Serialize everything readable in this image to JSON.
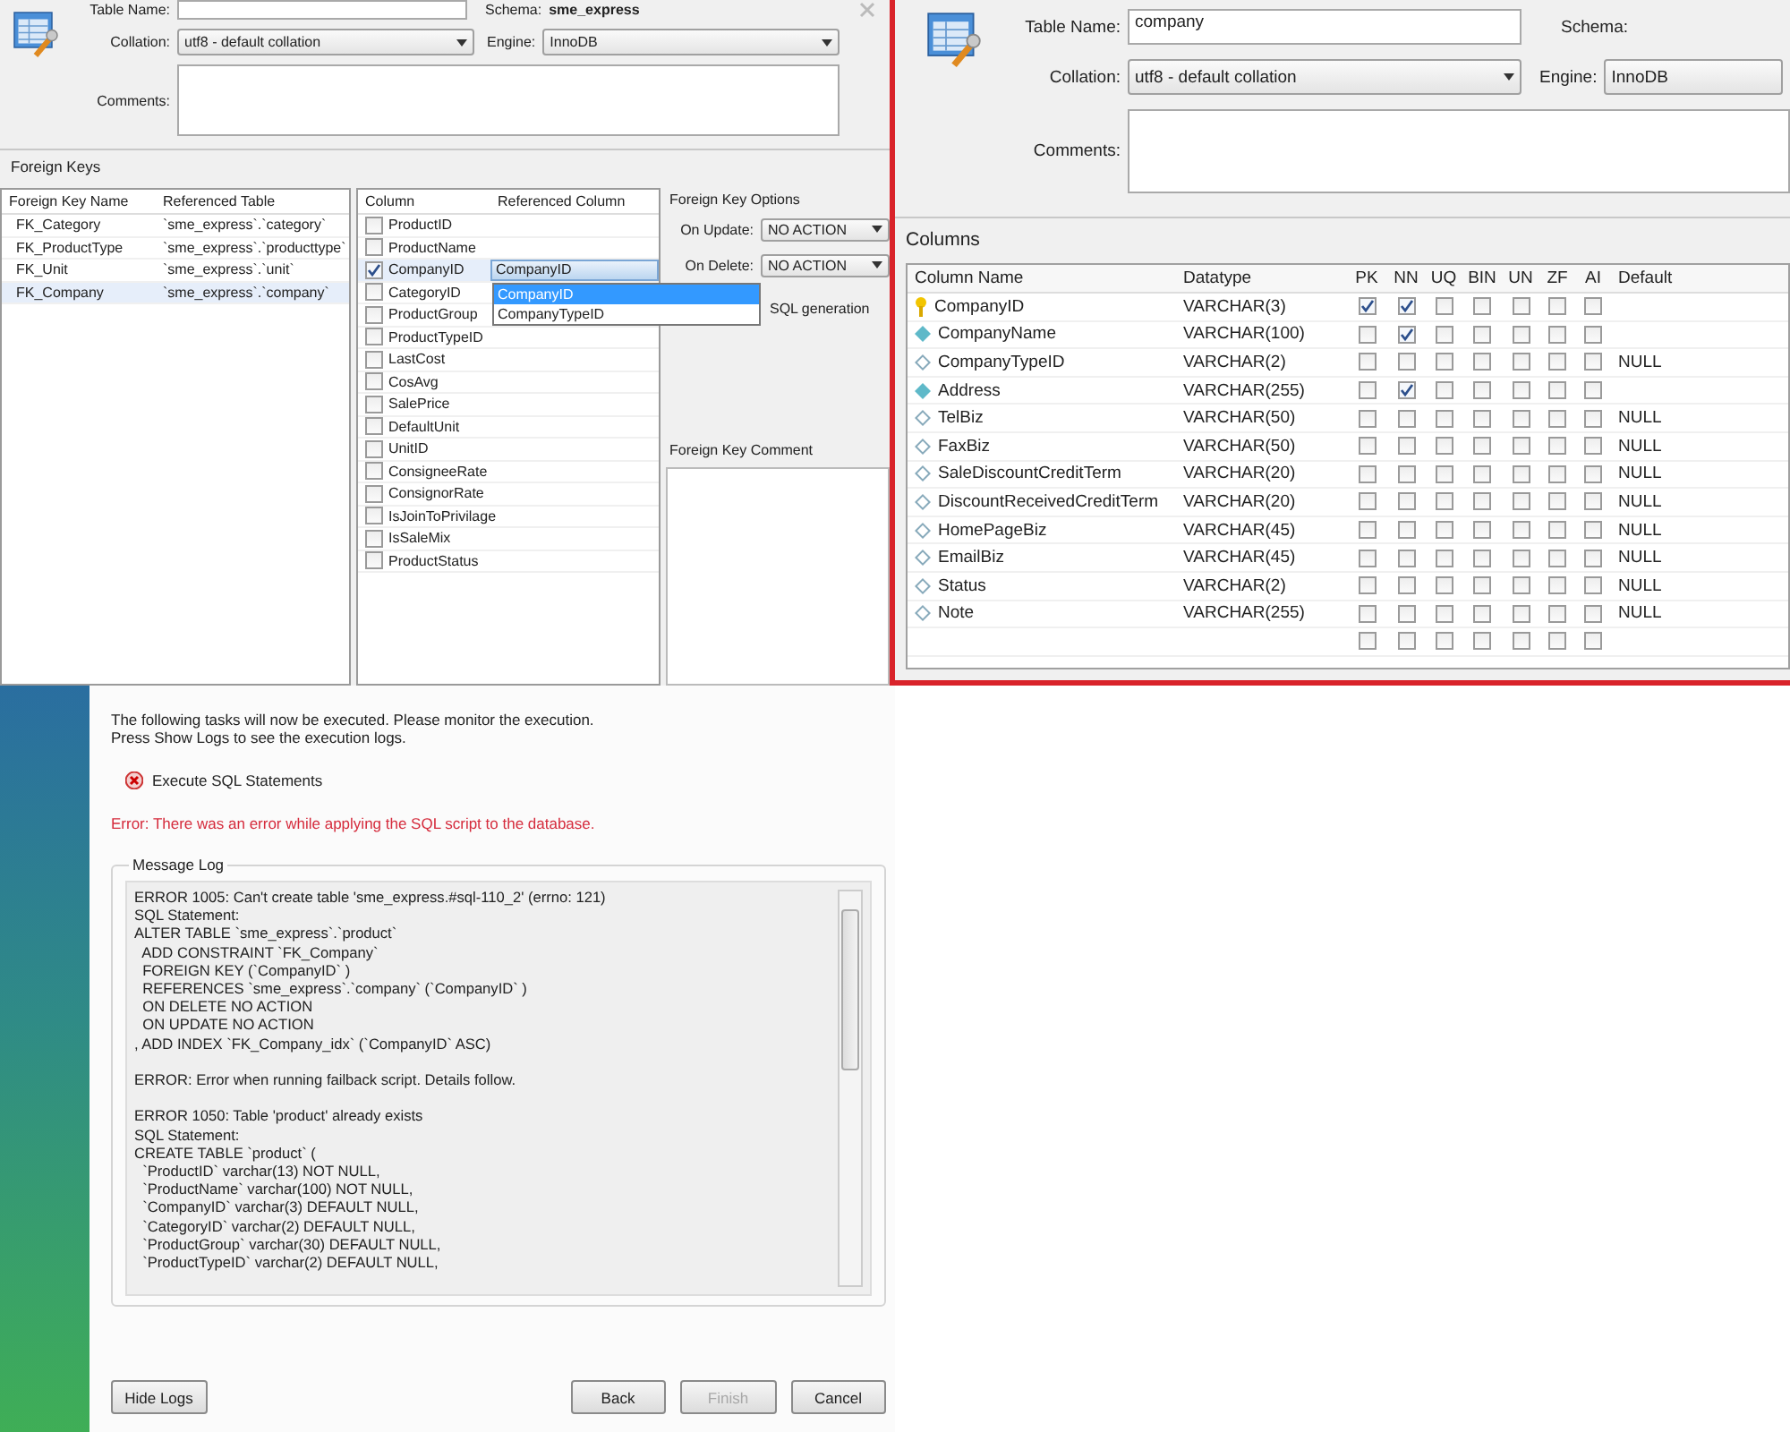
{
  "fk_editor": {
    "table_name_label": "Table Name:",
    "schema_label": "Schema:",
    "schema_value": "sme_express",
    "collation_label": "Collation:",
    "collation_value": "utf8 - default collation",
    "engine_label": "Engine:",
    "engine_value": "InnoDB",
    "comments_label": "Comments:",
    "section_title": "Foreign Keys",
    "fk_table": {
      "columns": [
        "Foreign Key Name",
        "Referenced Table"
      ],
      "rows": [
        {
          "name": "FK_Category",
          "table": "`sme_express`.`category`",
          "selected": false
        },
        {
          "name": "FK_ProductType",
          "table": "`sme_express`.`producttype`",
          "selected": false
        },
        {
          "name": "FK_Unit",
          "table": "`sme_express`.`unit`",
          "selected": false
        },
        {
          "name": "FK_Company",
          "table": "`sme_express`.`company`",
          "selected": true
        }
      ]
    },
    "column_table": {
      "columns": [
        "Column",
        "Referenced Column"
      ],
      "rows": [
        {
          "name": "ProductID",
          "checked": false,
          "selected": false
        },
        {
          "name": "ProductName",
          "checked": false,
          "selected": false
        },
        {
          "name": "CompanyID",
          "checked": true,
          "selected": true,
          "referenced": {
            "value": "CompanyID",
            "options": [
              {
                "label": "CompanyID",
                "selected": true
              },
              {
                "label": "CompanyTypeID",
                "selected": false
              }
            ]
          }
        },
        {
          "name": "CategoryID",
          "checked": false,
          "selected": false
        },
        {
          "name": "ProductGroup",
          "checked": false,
          "selected": false
        },
        {
          "name": "ProductTypeID",
          "checked": false,
          "selected": false
        },
        {
          "name": "LastCost",
          "checked": false,
          "selected": false
        },
        {
          "name": "CosAvg",
          "checked": false,
          "selected": false
        },
        {
          "name": "SalePrice",
          "checked": false,
          "selected": false
        },
        {
          "name": "DefaultUnit",
          "checked": false,
          "selected": false
        },
        {
          "name": "UnitID",
          "checked": false,
          "selected": false
        },
        {
          "name": "ConsigneeRate",
          "checked": false,
          "selected": false
        },
        {
          "name": "ConsignorRate",
          "checked": false,
          "selected": false
        },
        {
          "name": "IsJoinToPrivilage",
          "checked": false,
          "selected": false
        },
        {
          "name": "IsSaleMix",
          "checked": false,
          "selected": false
        },
        {
          "name": "ProductStatus",
          "checked": false,
          "selected": false
        }
      ]
    },
    "options": {
      "title": "Foreign Key Options",
      "on_update_label": "On Update:",
      "on_update_value": "NO ACTION",
      "on_delete_label": "On Delete:",
      "on_delete_value": "NO ACTION",
      "skip_label": "SQL generation",
      "comment_title": "Foreign Key Comment"
    }
  },
  "table_editor": {
    "table_name_label": "Table Name:",
    "table_name_value": "company",
    "schema_label": "Schema:",
    "collation_label": "Collation:",
    "collation_value": "utf8 - default collation",
    "engine_label": "Engine:",
    "engine_value": "InnoDB",
    "comments_label": "Comments:",
    "columns_title": "Columns",
    "table": {
      "columns": [
        "Column Name",
        "Datatype",
        "PK",
        "NN",
        "UQ",
        "BIN",
        "UN",
        "ZF",
        "AI",
        "Default"
      ],
      "rows": [
        {
          "kind": "primary",
          "name": "CompanyID",
          "datatype": "VARCHAR(3)",
          "flags": [
            true,
            true,
            false,
            false,
            false,
            false,
            false
          ]
        },
        {
          "kind": "required",
          "name": "CompanyName",
          "datatype": "VARCHAR(100)",
          "flags": [
            false,
            true,
            false,
            false,
            false,
            false,
            false
          ]
        },
        {
          "kind": "optional",
          "name": "CompanyTypeID",
          "datatype": "VARCHAR(2)",
          "flags": [
            false,
            false,
            false,
            false,
            false,
            false,
            false
          ],
          "default": "NULL"
        },
        {
          "kind": "required",
          "name": "Address",
          "datatype": "VARCHAR(255)",
          "flags": [
            false,
            true,
            false,
            false,
            false,
            false,
            false
          ]
        },
        {
          "kind": "optional",
          "name": "TelBiz",
          "datatype": "VARCHAR(50)",
          "flags": [
            false,
            false,
            false,
            false,
            false,
            false,
            false
          ],
          "default": "NULL"
        },
        {
          "kind": "optional",
          "name": "FaxBiz",
          "datatype": "VARCHAR(50)",
          "flags": [
            false,
            false,
            false,
            false,
            false,
            false,
            false
          ],
          "default": "NULL"
        },
        {
          "kind": "optional",
          "name": "SaleDiscountCreditTerm",
          "datatype": "VARCHAR(20)",
          "flags": [
            false,
            false,
            false,
            false,
            false,
            false,
            false
          ],
          "default": "NULL"
        },
        {
          "kind": "optional",
          "name": "DiscountReceivedCreditTerm",
          "datatype": "VARCHAR(20)",
          "flags": [
            false,
            false,
            false,
            false,
            false,
            false,
            false
          ],
          "default": "NULL"
        },
        {
          "kind": "optional",
          "name": "HomePageBiz",
          "datatype": "VARCHAR(45)",
          "flags": [
            false,
            false,
            false,
            false,
            false,
            false,
            false
          ],
          "default": "NULL"
        },
        {
          "kind": "optional",
          "name": "EmailBiz",
          "datatype": "VARCHAR(45)",
          "flags": [
            false,
            false,
            false,
            false,
            false,
            false,
            false
          ],
          "default": "NULL"
        },
        {
          "kind": "optional",
          "name": "Status",
          "datatype": "VARCHAR(2)",
          "flags": [
            false,
            false,
            false,
            false,
            false,
            false,
            false
          ],
          "default": "NULL"
        },
        {
          "kind": "optional",
          "name": "Note",
          "datatype": "VARCHAR(255)",
          "flags": [
            false,
            false,
            false,
            false,
            false,
            false,
            false
          ],
          "default": "NULL"
        },
        {
          "kind": "blank",
          "flags": [
            false,
            false,
            false,
            false,
            false,
            false,
            false
          ]
        }
      ]
    }
  },
  "apply_dialog": {
    "intro": [
      "The following tasks will now be executed. Please monitor the execution.",
      "Press Show Logs to see the execution logs."
    ],
    "task": {
      "label": "Execute SQL Statements",
      "failed": true
    },
    "error_message": "Error: There was an error while applying the SQL script to the database.",
    "log_title": "Message Log",
    "log_blocks": [
      [
        "ERROR 1005: Can't create table 'sme_express.#sql-110_2' (errno: 121)",
        "SQL Statement:",
        "ALTER TABLE `sme_express`.`product`",
        "  ADD CONSTRAINT `FK_Company`",
        "  FOREIGN KEY (`CompanyID` )",
        "  REFERENCES `sme_express`.`company` (`CompanyID` )",
        "  ON DELETE NO ACTION",
        "  ON UPDATE NO ACTION",
        ", ADD INDEX `FK_Company_idx` (`CompanyID` ASC)"
      ],
      [
        "ERROR: Error when running failback script. Details follow."
      ],
      [
        "ERROR 1050: Table 'product' already exists",
        "SQL Statement:",
        "CREATE TABLE `product` (",
        "  `ProductID` varchar(13) NOT NULL,",
        "  `ProductName` varchar(100) NOT NULL,",
        "  `CompanyID` varchar(3) DEFAULT NULL,",
        "  `CategoryID` varchar(2) DEFAULT NULL,",
        "  `ProductGroup` varchar(30) DEFAULT NULL,",
        "  `ProductTypeID` varchar(2) DEFAULT NULL,"
      ]
    ],
    "buttons": [
      {
        "label": "Hide Logs",
        "disabled": false
      },
      {
        "label": "Back",
        "disabled": false
      },
      {
        "label": "Finish",
        "disabled": true
      },
      {
        "label": "Cancel",
        "disabled": false
      }
    ]
  }
}
